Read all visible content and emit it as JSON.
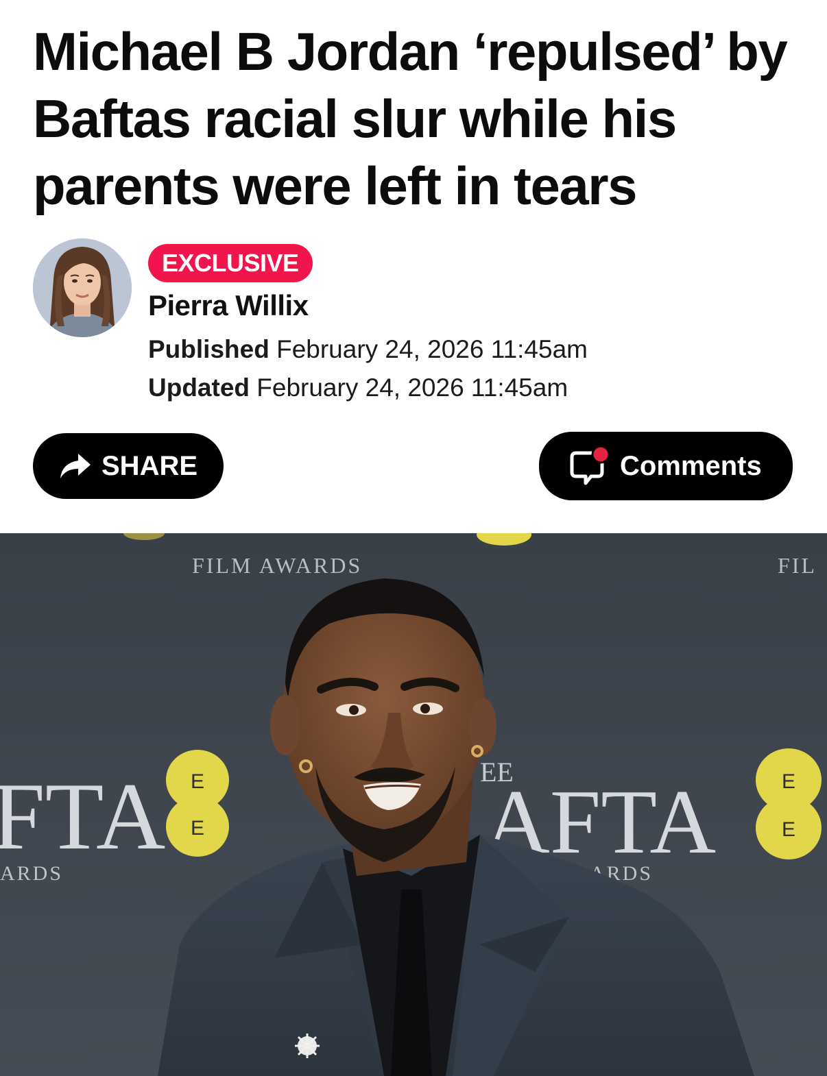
{
  "article": {
    "headline": "Michael B Jordan ‘repulsed’ by Baftas racial slur while his parents were left in tears"
  },
  "byline": {
    "badge": "EXCLUSIVE",
    "author": "Pierra Willix",
    "published_label": "Published",
    "published_value": "February 24, 2026 11:45am",
    "updated_label": "Updated",
    "updated_value": "February 24, 2026 11:45am"
  },
  "actions": {
    "share_label": "SHARE",
    "comments_label": "Comments"
  },
  "hero_image": {
    "backdrop_text_left": "FTA",
    "backdrop_sub_left": "ARDS",
    "backdrop_text_right": "AFTA",
    "backdrop_sub_right": "ARDS",
    "backdrop_top": "FILM AWARDS",
    "backdrop_top_right": "FIL",
    "logo_letters": "EE"
  },
  "colors": {
    "badge": "#f0154a",
    "notification_dot": "#e8233f",
    "button_bg": "#000000",
    "backdrop": "#3f454d",
    "ee_yellow": "#e2d74a"
  },
  "icons": [
    "share-arrow-icon",
    "comment-bubble-icon",
    "notification-dot-icon"
  ]
}
